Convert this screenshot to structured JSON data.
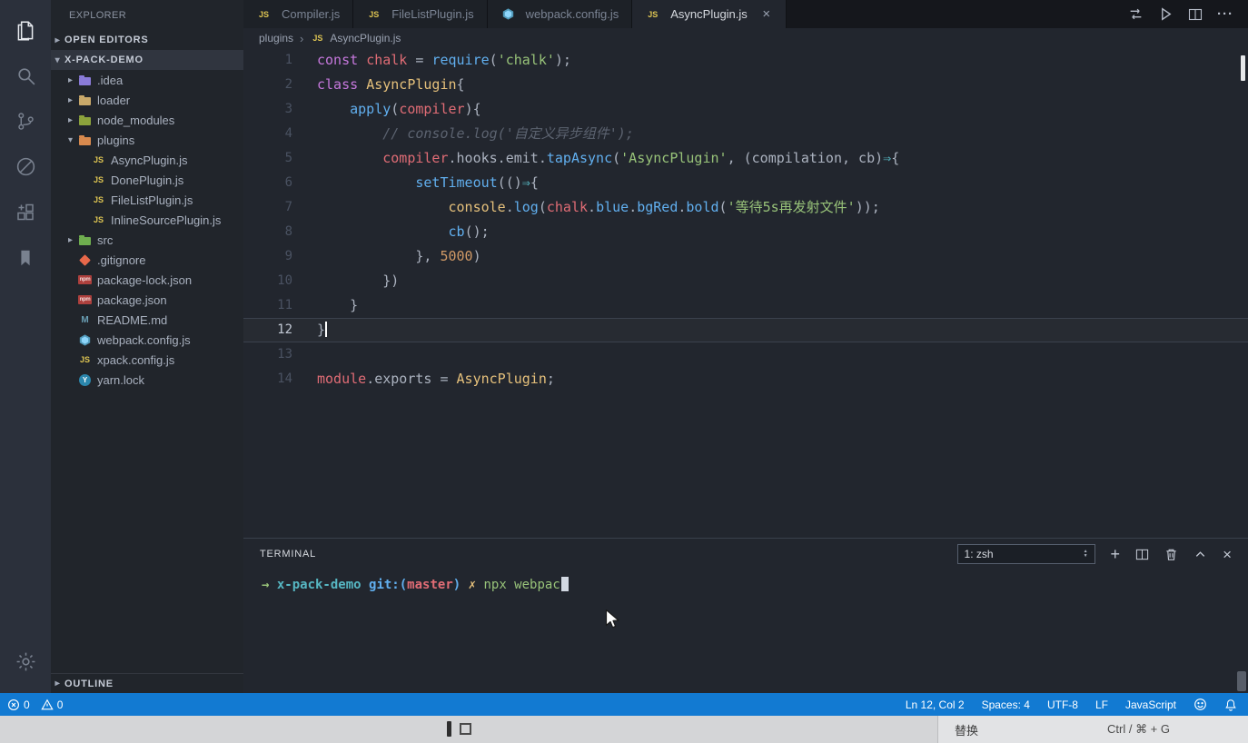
{
  "activity_bar": {
    "items": [
      {
        "name": "explorer",
        "active": true
      },
      {
        "name": "search",
        "active": false
      },
      {
        "name": "source-control",
        "active": false
      },
      {
        "name": "debug",
        "active": false
      },
      {
        "name": "extensions",
        "active": false
      },
      {
        "name": "bookmarks",
        "active": false
      }
    ],
    "bottom_items": [
      {
        "name": "settings",
        "active": false
      }
    ]
  },
  "sidebar": {
    "title": "EXPLORER",
    "sections": {
      "open_editors": "OPEN EDITORS",
      "root": "X-PACK-DEMO",
      "outline": "OUTLINE"
    },
    "tree": [
      {
        "label": ".idea",
        "icon": "folder-idea",
        "indent": 1,
        "chevron": "right"
      },
      {
        "label": "loader",
        "icon": "folder",
        "indent": 1,
        "chevron": "right"
      },
      {
        "label": "node_modules",
        "icon": "folder-nm",
        "indent": 1,
        "chevron": "right"
      },
      {
        "label": "plugins",
        "icon": "folder-open",
        "indent": 1,
        "chevron": "down"
      },
      {
        "label": "AsyncPlugin.js",
        "icon": "js",
        "indent": 2
      },
      {
        "label": "DonePlugin.js",
        "icon": "js",
        "indent": 2
      },
      {
        "label": "FileListPlugin.js",
        "icon": "js",
        "indent": 2
      },
      {
        "label": "InlineSourcePlugin.js",
        "icon": "js",
        "indent": 2
      },
      {
        "label": "src",
        "icon": "folder-src",
        "indent": 1,
        "chevron": "right"
      },
      {
        "label": ".gitignore",
        "icon": "git",
        "indent": 1
      },
      {
        "label": "package-lock.json",
        "icon": "npm",
        "indent": 1
      },
      {
        "label": "package.json",
        "icon": "npm",
        "indent": 1
      },
      {
        "label": "README.md",
        "icon": "md",
        "indent": 1
      },
      {
        "label": "webpack.config.js",
        "icon": "webpack",
        "indent": 1
      },
      {
        "label": "xpack.config.js",
        "icon": "js",
        "indent": 1
      },
      {
        "label": "yarn.lock",
        "icon": "yarn",
        "indent": 1
      }
    ]
  },
  "tabs": {
    "items": [
      {
        "label": "Compiler.js",
        "icon": "js",
        "active": false
      },
      {
        "label": "FileListPlugin.js",
        "icon": "js",
        "active": false
      },
      {
        "label": "webpack.config.js",
        "icon": "webpack",
        "active": false
      },
      {
        "label": "AsyncPlugin.js",
        "icon": "js",
        "active": true,
        "close": "×"
      }
    ],
    "actions": [
      {
        "name": "compare-changes"
      },
      {
        "name": "run"
      },
      {
        "name": "split-editor"
      },
      {
        "name": "more-actions"
      }
    ]
  },
  "breadcrumb": [
    {
      "label": "plugins"
    },
    {
      "label": "AsyncPlugin.js",
      "icon": "js"
    }
  ],
  "editor": {
    "lines": [
      {
        "num": 1,
        "tokens": [
          [
            "kw",
            "const"
          ],
          [
            "def",
            " "
          ],
          [
            "var",
            "chalk"
          ],
          [
            "def",
            " = "
          ],
          [
            "fn",
            "require"
          ],
          [
            "def",
            "("
          ],
          [
            "str",
            "'chalk'"
          ],
          [
            "def",
            ");"
          ]
        ]
      },
      {
        "num": 2,
        "tokens": [
          [
            "kw",
            "class"
          ],
          [
            "def",
            " "
          ],
          [
            "cls",
            "AsyncPlugin"
          ],
          [
            "def",
            "{"
          ]
        ]
      },
      {
        "num": 3,
        "tokens": [
          [
            "def",
            "    "
          ],
          [
            "fn",
            "apply"
          ],
          [
            "def",
            "("
          ],
          [
            "var",
            "compiler"
          ],
          [
            "def",
            "){"
          ]
        ]
      },
      {
        "num": 4,
        "tokens": [
          [
            "com",
            "        // console.log('自定义异步组件');"
          ]
        ]
      },
      {
        "num": 5,
        "tokens": [
          [
            "def",
            "        "
          ],
          [
            "var",
            "compiler"
          ],
          [
            "def",
            ".hooks.emit."
          ],
          [
            "fn",
            "tapAsync"
          ],
          [
            "def",
            "("
          ],
          [
            "str",
            "'AsyncPlugin'"
          ],
          [
            "def",
            ", (compilation, cb)"
          ],
          [
            "arrow",
            "⇒"
          ],
          [
            "def",
            "{"
          ]
        ]
      },
      {
        "num": 6,
        "tokens": [
          [
            "def",
            "            "
          ],
          [
            "fn",
            "setTimeout"
          ],
          [
            "def",
            "(()"
          ],
          [
            "arrow",
            "⇒"
          ],
          [
            "def",
            "{"
          ]
        ]
      },
      {
        "num": 7,
        "tokens": [
          [
            "def",
            "                "
          ],
          [
            "cls",
            "console"
          ],
          [
            "def",
            "."
          ],
          [
            "fn",
            "log"
          ],
          [
            "def",
            "("
          ],
          [
            "var",
            "chalk"
          ],
          [
            "def",
            "."
          ],
          [
            "fn",
            "blue"
          ],
          [
            "def",
            "."
          ],
          [
            "fn",
            "bgRed"
          ],
          [
            "def",
            "."
          ],
          [
            "fn",
            "bold"
          ],
          [
            "def",
            "("
          ],
          [
            "str",
            "'等待5s再发射文件'"
          ],
          [
            "def",
            "));"
          ]
        ]
      },
      {
        "num": 8,
        "tokens": [
          [
            "def",
            "                "
          ],
          [
            "fn",
            "cb"
          ],
          [
            "def",
            "();"
          ]
        ]
      },
      {
        "num": 9,
        "tokens": [
          [
            "def",
            "            }, "
          ],
          [
            "num",
            "5000"
          ],
          [
            "def",
            ")"
          ]
        ]
      },
      {
        "num": 10,
        "tokens": [
          [
            "def",
            "        })"
          ]
        ]
      },
      {
        "num": 11,
        "tokens": [
          [
            "def",
            "    }"
          ]
        ]
      },
      {
        "num": 12,
        "tokens": [
          [
            "def",
            "}"
          ]
        ],
        "active": true,
        "cursor": true
      },
      {
        "num": 13,
        "tokens": []
      },
      {
        "num": 14,
        "tokens": [
          [
            "var",
            "module"
          ],
          [
            "def",
            ".exports = "
          ],
          [
            "cls",
            "AsyncPlugin"
          ],
          [
            "def",
            ";"
          ]
        ]
      }
    ]
  },
  "terminal": {
    "title": "TERMINAL",
    "shell_select": "1: zsh",
    "prompt": [
      [
        "green",
        "→  "
      ],
      [
        "cyan",
        "x-pack-demo "
      ],
      [
        "blue",
        "git:("
      ],
      [
        "red",
        "master"
      ],
      [
        "blue",
        ") "
      ],
      [
        "yellow",
        "✗ "
      ],
      [
        "cmd",
        "npx webpac"
      ]
    ],
    "actions": [
      {
        "name": "new-terminal"
      },
      {
        "name": "split-terminal"
      },
      {
        "name": "kill-terminal"
      },
      {
        "name": "maximize-panel"
      },
      {
        "name": "close-panel"
      }
    ]
  },
  "status_bar": {
    "left": [
      {
        "name": "errors",
        "icon": "error",
        "value": "0"
      },
      {
        "name": "warnings",
        "icon": "warning",
        "value": "0"
      }
    ],
    "right": [
      {
        "name": "cursor-position",
        "label": "Ln 12, Col 2"
      },
      {
        "name": "indentation",
        "label": "Spaces: 4"
      },
      {
        "name": "encoding",
        "label": "UTF-8"
      },
      {
        "name": "eol",
        "label": "LF"
      },
      {
        "name": "language-mode",
        "label": "JavaScript"
      }
    ],
    "right_icons": [
      {
        "name": "feedback",
        "icon": "smiley"
      },
      {
        "name": "notifications",
        "icon": "bell"
      }
    ]
  },
  "background_bar": {
    "replace_label": "替换",
    "shortcut_label": "Ctrl / ⌘ + G"
  }
}
